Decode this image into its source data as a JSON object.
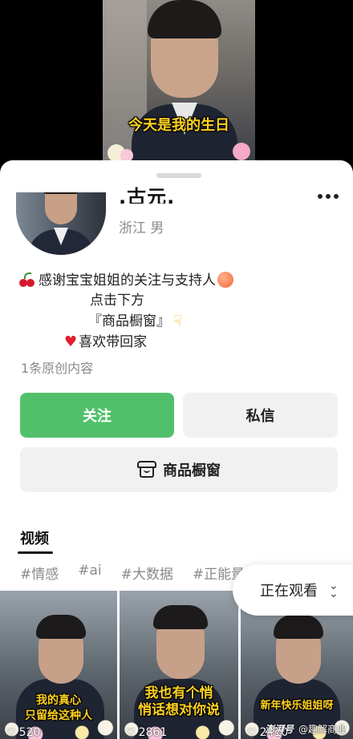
{
  "video": {
    "subtitle": "今天是我的生日"
  },
  "profile": {
    "name": ".古元.",
    "location": "浙江",
    "gender": "男",
    "bio": {
      "line1": "感谢宝宝姐姐的关注与支持人",
      "line2": "点击下方",
      "line3": "『商品橱窗』",
      "line4": "喜欢带回家"
    },
    "original_count": "1条原创内容"
  },
  "actions": {
    "follow": "关注",
    "message": "私信",
    "shop": "商品橱窗"
  },
  "tabs": {
    "video": "视频"
  },
  "tags": [
    "#情感",
    "#ai",
    "#大数据",
    "#正能量"
  ],
  "watching": {
    "label": "正在观看"
  },
  "videos": [
    {
      "caption": "我的真心\n只留给这种人",
      "likes": "520"
    },
    {
      "caption": "我也有个悄\n悄话想对你说",
      "likes": "2861"
    },
    {
      "caption": "新年快乐姐姐呀",
      "likes": "2410"
    }
  ],
  "watermark": {
    "brand": "澎湃号",
    "account": "@趣解商业"
  },
  "colors": {
    "accent": "#52c06a",
    "subtitle": "#ffd21f"
  }
}
